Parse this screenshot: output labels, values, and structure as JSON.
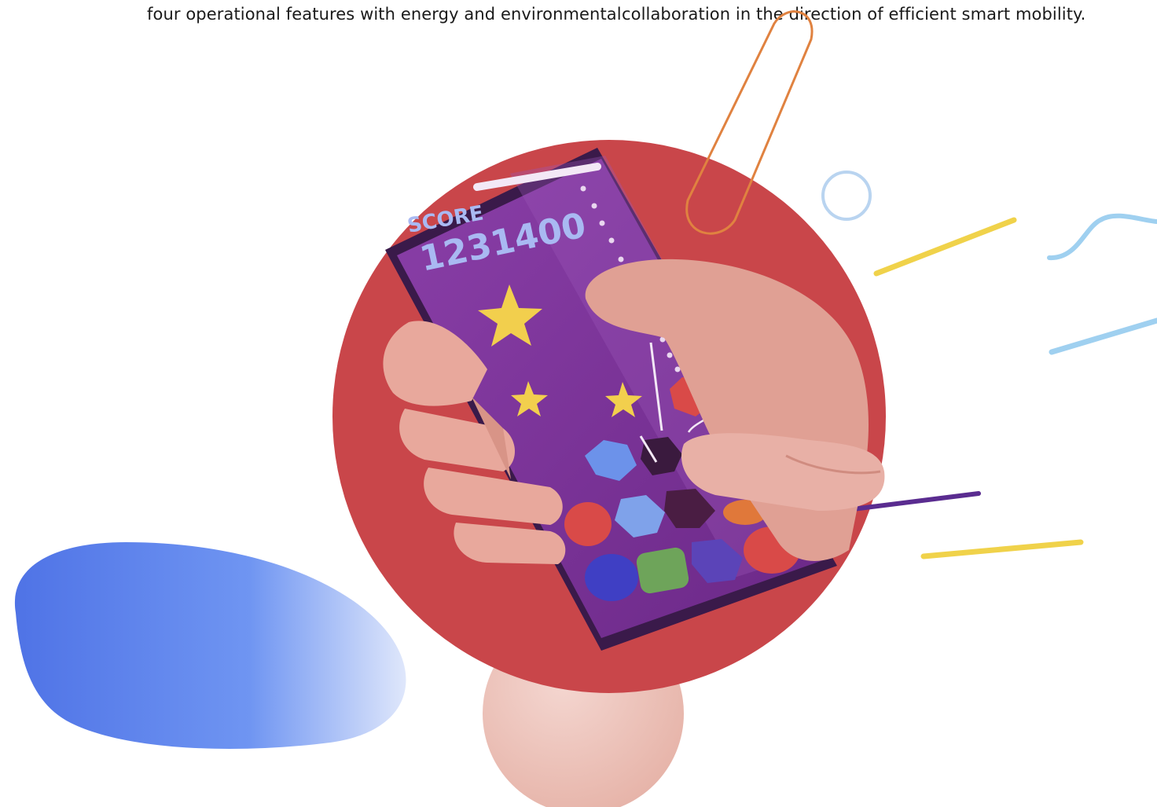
{
  "article": {
    "column_left_text": "four operational features with energy and environmental",
    "column_right_text": "collaboration in the direction of efficient smart mobility."
  },
  "illustration": {
    "game_score_label": "SCORE",
    "game_score_value": "1231400"
  },
  "colors": {
    "red_circle": "#c9464a",
    "phone_screen": "#7a2e98",
    "star": "#f2cf4d",
    "skin": "#e8a89c",
    "blue_blob": "#5f86ef"
  }
}
